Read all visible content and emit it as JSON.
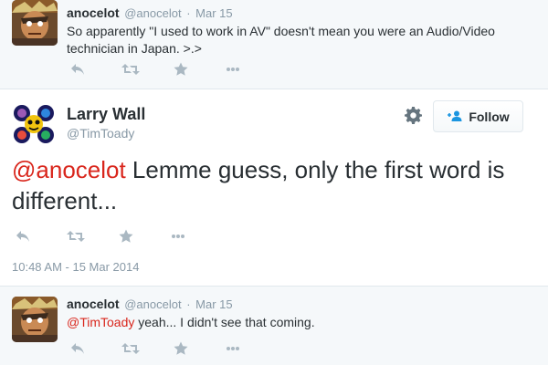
{
  "reply_top": {
    "fullname": "anocelot",
    "username": "@anocelot",
    "separator": "·",
    "date": "Mar 15",
    "text": "So apparently \"I used to work in AV\" doesn't mean you were an Audio/Video technician in Japan. >.>"
  },
  "main_tweet": {
    "fullname": "Larry Wall",
    "username": "@TimToady",
    "follow_label": "Follow",
    "mention": "@anocelot",
    "text": " Lemme guess, only the first word is different...",
    "timestamp": "10:48 AM - 15 Mar 2014"
  },
  "reply_bottom": {
    "fullname": "anocelot",
    "username": "@anocelot",
    "separator": "·",
    "date": "Mar 15",
    "mention": "@TimToady",
    "text": " yeah... I didn't see that coming."
  },
  "colors": {
    "mention": "#d9261c",
    "icon": "#aab8c2",
    "muted": "#8899a6",
    "follow_icon": "#1b95e0"
  },
  "icons": {
    "reply": "reply-icon",
    "retweet": "retweet-icon",
    "favorite": "star-icon",
    "more": "more-icon",
    "settings": "gear-icon",
    "follow": "add-user-icon"
  }
}
